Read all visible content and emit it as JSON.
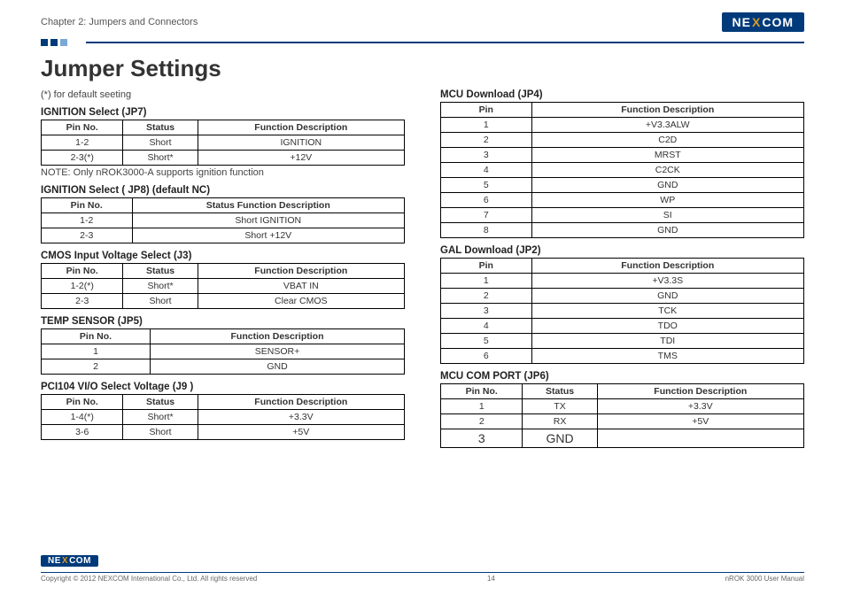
{
  "header": {
    "chapter": "Chapter 2: Jumpers and Connectors",
    "logo_pre": "NE",
    "logo_x": "X",
    "logo_post": "COM"
  },
  "title": "Jumper Settings",
  "default_note": "(*) for default seeting",
  "ignition_note": "NOTE: Only nROK3000-A supports ignition function",
  "sections_left": [
    {
      "title": "IGNITION Select (JP7)",
      "headers": [
        "Pin No.",
        "Status",
        "Function Description"
      ],
      "rows": [
        [
          "1-2",
          "Short",
          "IGNITION"
        ],
        [
          "2-3(*)",
          "Short*",
          "+12V"
        ]
      ],
      "after_note": true
    },
    {
      "title": "IGNITION Select ( JP8)   (default NC)",
      "headers": [
        "Pin No.",
        "Status Function Description"
      ],
      "rows": [
        [
          "1-2",
          "Short IGNITION"
        ],
        [
          "2-3",
          "Short +12V"
        ]
      ]
    },
    {
      "title": "CMOS Input Voltage Select (J3)",
      "headers": [
        "Pin No.",
        "Status",
        "Function Description"
      ],
      "rows": [
        [
          "1-2(*)",
          "Short*",
          "VBAT IN"
        ],
        [
          "2-3",
          "Short",
          "Clear CMOS"
        ]
      ]
    },
    {
      "title": "TEMP SENSOR (JP5)",
      "headers": [
        "Pin No.",
        "Function Description"
      ],
      "rows": [
        [
          "1",
          "SENSOR+"
        ],
        [
          "2",
          "GND"
        ]
      ]
    },
    {
      "title": "PCI104 VI/O Select Voltage (J9 )",
      "headers": [
        "Pin No.",
        "Status",
        "Function Description"
      ],
      "rows": [
        [
          "1-4(*)",
          "Short*",
          "+3.3V"
        ],
        [
          "3-6",
          "Short",
          "+5V"
        ]
      ]
    }
  ],
  "sections_right": [
    {
      "title": "MCU Download (JP4)",
      "headers": [
        "Pin",
        "Function Description"
      ],
      "rows": [
        [
          "1",
          "+V3.3ALW"
        ],
        [
          "2",
          "C2D"
        ],
        [
          "3",
          "MRST"
        ],
        [
          "4",
          "C2CK"
        ],
        [
          "5",
          "GND"
        ],
        [
          "6",
          "WP"
        ],
        [
          "7",
          "SI"
        ],
        [
          "8",
          "GND"
        ]
      ]
    },
    {
      "title": "GAL Download (JP2)",
      "headers": [
        "Pin",
        "Function Description"
      ],
      "rows": [
        [
          "1",
          "+V3.3S"
        ],
        [
          "2",
          "GND"
        ],
        [
          "3",
          "TCK"
        ],
        [
          "4",
          "TDO"
        ],
        [
          "5",
          "TDI"
        ],
        [
          "6",
          "TMS"
        ]
      ]
    },
    {
      "title": "MCU COM PORT (JP6)",
      "headers": [
        "Pin No.",
        "Status",
        "Function Description"
      ],
      "rows": [
        [
          "1",
          "TX",
          "+3.3V"
        ],
        [
          "2",
          "RX",
          "+5V"
        ],
        [
          "3",
          "GND",
          ""
        ]
      ],
      "big_last": true
    }
  ],
  "footer": {
    "copyright": "Copyright © 2012 NEXCOM International Co., Ltd. All rights reserved",
    "page": "14",
    "manual": "nROK 3000 User Manual"
  }
}
